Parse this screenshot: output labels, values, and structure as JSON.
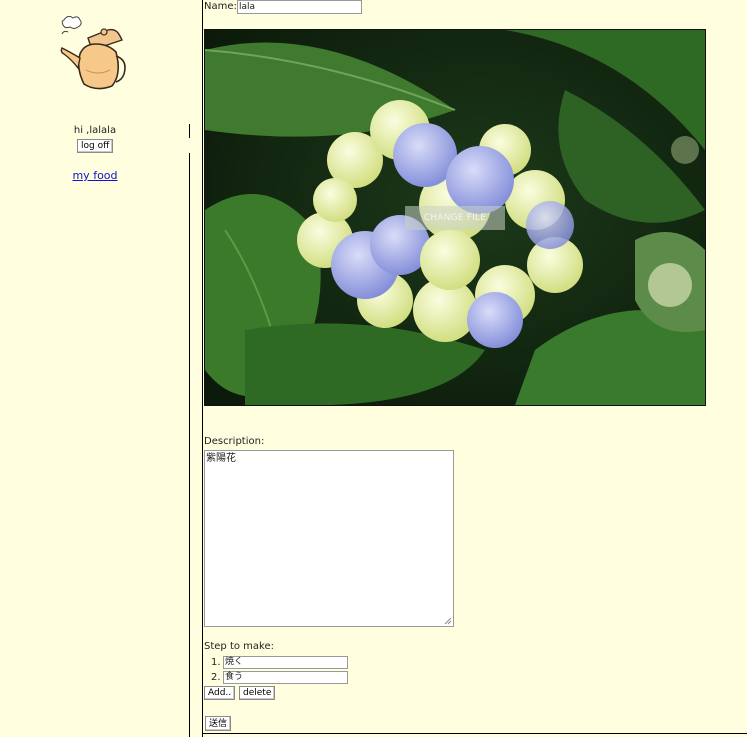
{
  "sidebar": {
    "greeting": "hi ,lalala",
    "logoff_label": "log off",
    "my_food_link": "my food"
  },
  "form": {
    "name_label": "Name:",
    "name_value": "lala",
    "change_file_label": "CHANGE FILE",
    "description_label": "Description:",
    "description_value": "紫陽花",
    "steps_label": "Step to make:",
    "steps": [
      {
        "number": "1.",
        "value": "焼く"
      },
      {
        "number": "2.",
        "value": "食う"
      }
    ],
    "add_label": "Add..",
    "delete_label": "delete",
    "submit_label": "送信"
  },
  "colors": {
    "background": "#ffffe0",
    "link": "#1010d0",
    "leaf_dark": "#163315",
    "flower_blue": "#9aa3e8",
    "flower_cream": "#eef3b8"
  },
  "icons": {
    "logo": "steaming-kettle-icon"
  }
}
